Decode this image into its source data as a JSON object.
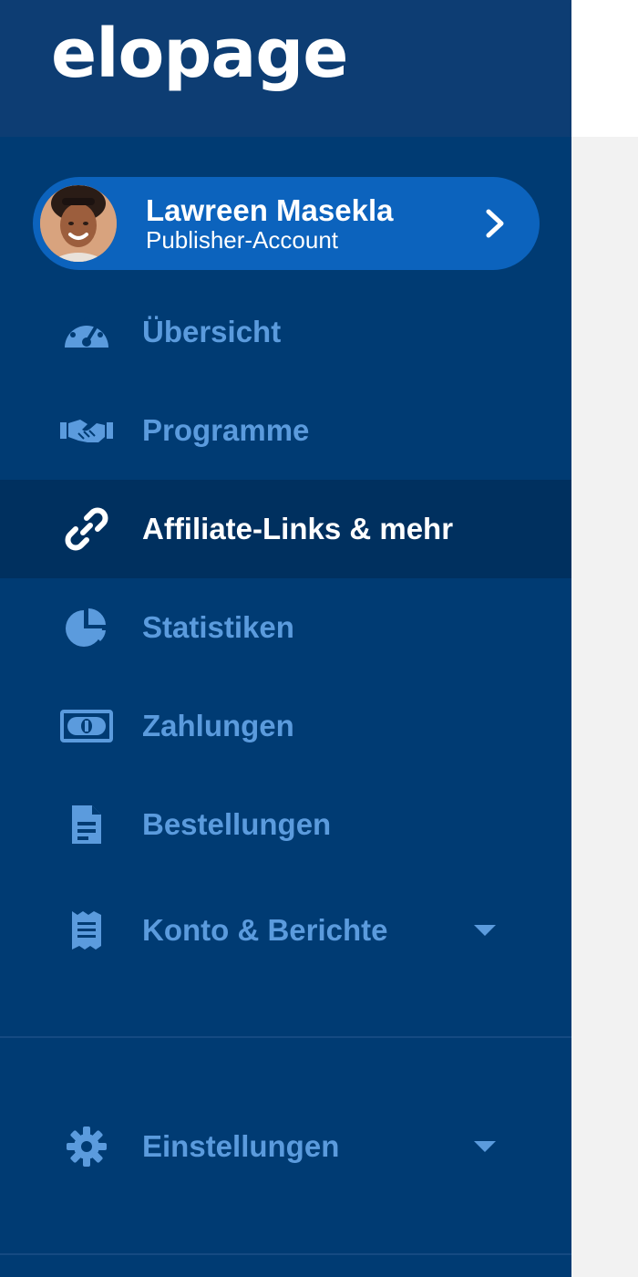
{
  "brand": {
    "logo_text": "elopage"
  },
  "profile": {
    "name": "Lawreen Masekla",
    "role": "Publisher-Account"
  },
  "nav": {
    "items": [
      {
        "label": "Übersicht",
        "icon": "dashboard-gauge-icon"
      },
      {
        "label": "Programme",
        "icon": "handshake-icon"
      },
      {
        "label": "Affiliate-Links & mehr",
        "icon": "link-icon",
        "active": true
      },
      {
        "label": "Statistiken",
        "icon": "pie-chart-icon"
      },
      {
        "label": "Zahlungen",
        "icon": "money-bill-icon"
      },
      {
        "label": "Bestellungen",
        "icon": "file-document-icon"
      },
      {
        "label": "Konto & Berichte",
        "icon": "receipt-icon",
        "expandable": true
      }
    ],
    "settings": {
      "label": "Einstellungen",
      "icon": "gear-icon",
      "expandable": true
    }
  },
  "colors": {
    "sidebar_bg": "#003b73",
    "brand_bg": "#0d3d73",
    "profile_bg": "#0c63bd",
    "active_bg": "#00305f",
    "nav_text": "#5b9bdd",
    "active_text": "#ffffff",
    "content_bg": "#f2f2f2"
  }
}
